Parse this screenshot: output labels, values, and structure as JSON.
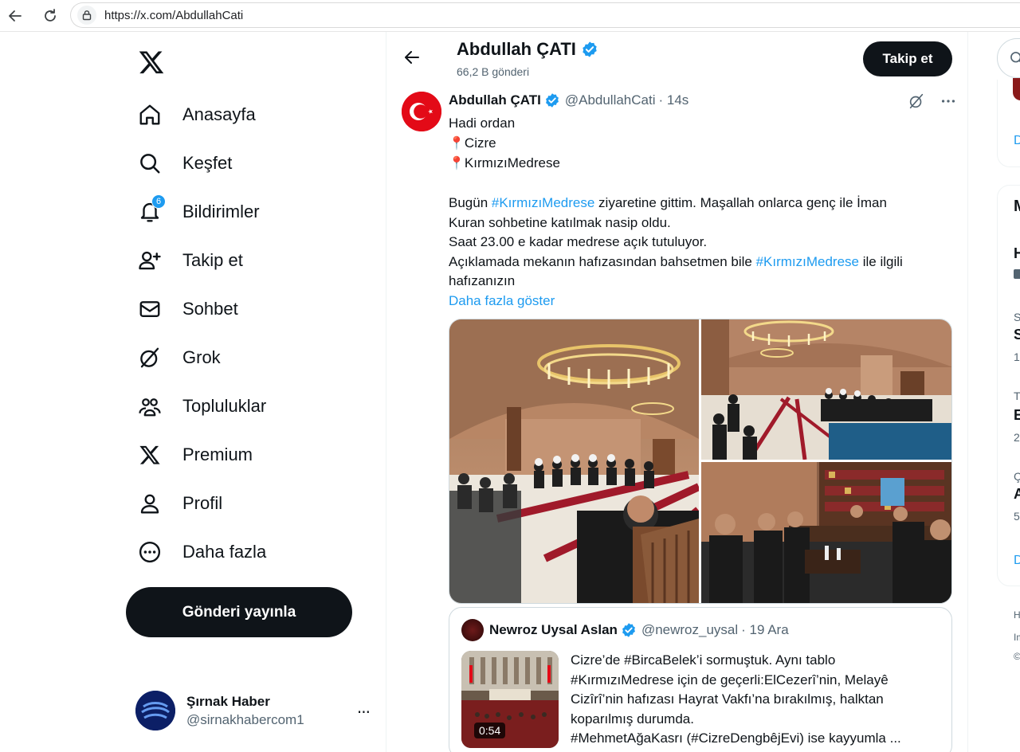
{
  "browser": {
    "url": "https://x.com/AbdullahCati"
  },
  "sidebar": {
    "items": [
      {
        "label": "Anasayfa",
        "icon": "home-icon"
      },
      {
        "label": "Keşfet",
        "icon": "search-icon"
      },
      {
        "label": "Bildirimler",
        "icon": "bell-icon",
        "badge": "6"
      },
      {
        "label": "Takip et",
        "icon": "follow-user-icon"
      },
      {
        "label": "Sohbet",
        "icon": "mail-icon"
      },
      {
        "label": "Grok",
        "icon": "grok-icon"
      },
      {
        "label": "Topluluklar",
        "icon": "communities-icon"
      },
      {
        "label": "Premium",
        "icon": "x-logo-icon"
      },
      {
        "label": "Profil",
        "icon": "profile-icon"
      },
      {
        "label": "Daha fazla",
        "icon": "more-circle-icon"
      }
    ],
    "post_button": "Gönderi yayınla",
    "account": {
      "name": "Şırnak Haber",
      "handle": "@sirnakhabercom1",
      "more": "···"
    }
  },
  "header": {
    "name": "Abdullah ÇATI",
    "posts": "66,2 B gönderi",
    "follow": "Takip et"
  },
  "tweet": {
    "name": "Abdullah ÇATI",
    "handle": "@AbdullahCati",
    "time": "· 14s",
    "lines": {
      "l1": "Hadi ordan",
      "l2": "Cizre",
      "l3": "KırmızıMedrese",
      "l4a": "Bugün ",
      "l4b": "#KırmızıMedrese",
      "l4c": " ziyaretine gittim. Maşallah onlarca genç ile İman",
      "l5": "Kuran sohbetine katılmak nasip oldu.",
      "l6": "Saat 23.00 e kadar medrese açık tutuluyor.",
      "l7a": "Açıklamada mekanın hafızasından bahsetmen bile ",
      "l7b": "#KırmızıMedrese",
      "l7c": " ile ilgili",
      "l8": "hafızanızın"
    },
    "show_more": "Daha fazla göster"
  },
  "quote": {
    "name": "Newroz Uysal Aslan",
    "handle": "@newroz_uysal",
    "time": "· 19 Ara",
    "duration": "0:54",
    "lines": [
      "Cizre’de #BircaBelek’i sormuştuk. Aynı tablo",
      "#KırmızıMedrese için de geçerli:ElCezerî’nin, Melayê",
      "Cizîrî’nin hafızası Hayrat Vakfı’na bırakılmış, halktan",
      "koparılmış durumda.",
      "#MehmetAğaKasrı (#CizreDengbêjEvi) ise kayyumla ..."
    ]
  },
  "right_fragments": {
    "d1": "D",
    "m": "M",
    "h": "H",
    "s1": "S",
    "s2": "S",
    "n1": "1(",
    "t": "T",
    "e": "E",
    "n2": "2",
    "c": "Ç",
    "a": "A",
    "n3": "5",
    "d2": "D",
    "f1": "H",
    "f2": "Im",
    "f3": "©"
  },
  "colors": {
    "accent": "#1d9bf0",
    "text": "#0f1419",
    "muted": "#536471",
    "verified": "#1d9bf0"
  }
}
